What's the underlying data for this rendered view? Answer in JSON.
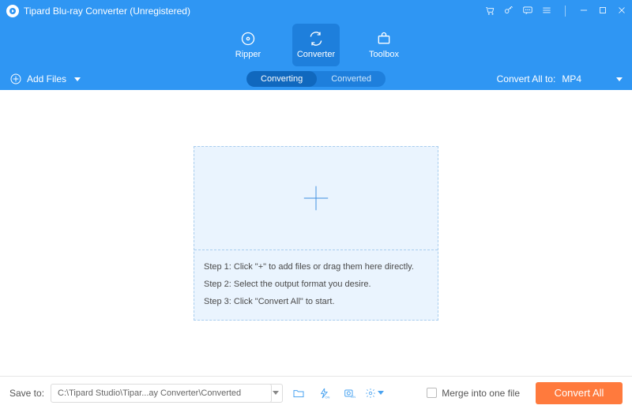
{
  "titlebar": {
    "title": "Tipard Blu-ray Converter (Unregistered)"
  },
  "nav": {
    "ripper": "Ripper",
    "converter": "Converter",
    "toolbox": "Toolbox"
  },
  "subbar": {
    "add_files": "Add Files",
    "tab_converting": "Converting",
    "tab_converted": "Converted",
    "convert_all_to": "Convert All to:",
    "format": "MP4"
  },
  "steps": {
    "s1": "Step 1: Click \"+\" to add files or drag them here directly.",
    "s2": "Step 2: Select the output format you desire.",
    "s3": "Step 3: Click \"Convert All\" to start."
  },
  "bottom": {
    "save_to": "Save to:",
    "path": "C:\\Tipard Studio\\Tipar...ay Converter\\Converted",
    "merge": "Merge into one file",
    "convert_all": "Convert All"
  }
}
